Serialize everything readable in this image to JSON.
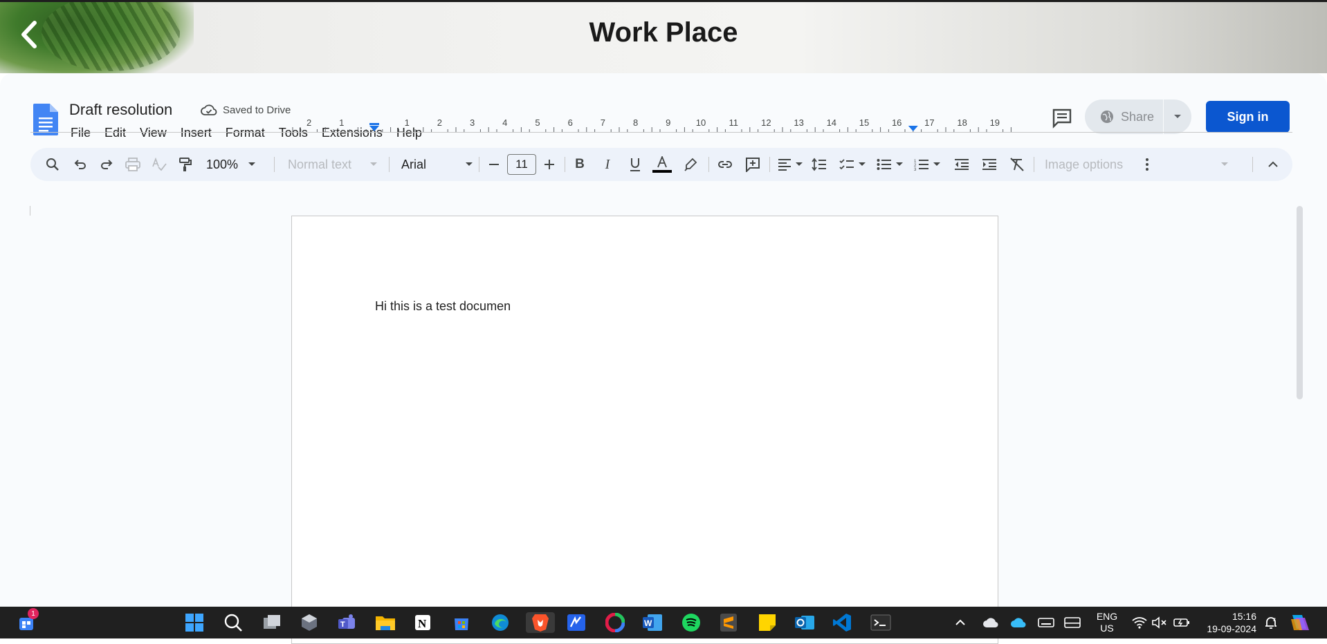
{
  "banner": {
    "title": "Work Place"
  },
  "doc": {
    "title": "Draft resolution",
    "saved_status": "Saved to Drive",
    "menu": [
      "File",
      "Edit",
      "View",
      "Insert",
      "Format",
      "Tools",
      "Extensions",
      "Help"
    ],
    "share_label": "Share",
    "signin_label": "Sign in",
    "body_text": "Hi this is a test documen"
  },
  "toolbar": {
    "zoom": "100%",
    "style": "Normal text",
    "font": "Arial",
    "font_size": "11",
    "image_options": "Image options",
    "text_color": "#000000"
  },
  "ruler": {
    "left_labels": [
      "2",
      "1"
    ],
    "right_labels": [
      "1",
      "2",
      "3",
      "4",
      "5",
      "6",
      "7",
      "8",
      "9",
      "10",
      "11",
      "12",
      "13",
      "14",
      "15",
      "16",
      "17",
      "18",
      "19"
    ]
  },
  "taskbar": {
    "notification_badge": "1",
    "lang_top": "ENG",
    "lang_bottom": "US",
    "time": "15:16",
    "date": "19-09-2024"
  },
  "colors": {
    "accent": "#0b57d0",
    "marker": "#1a73e8"
  }
}
